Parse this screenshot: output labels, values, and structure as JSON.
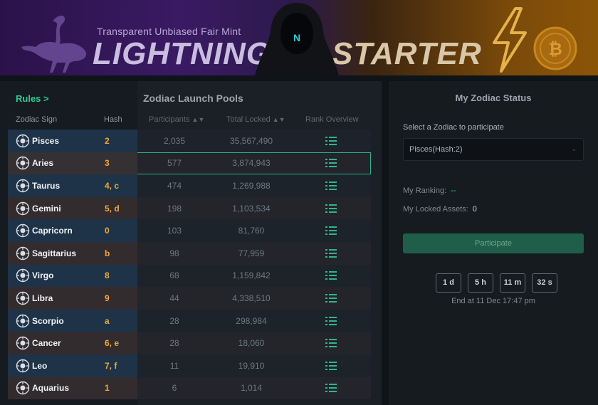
{
  "banner": {
    "tagline": "Transparent Unbiased Fair Mint",
    "title_left": "LIGHTNING",
    "title_right": "STARTER",
    "hood_letter": "N"
  },
  "table": {
    "rules_link": "Rules >",
    "pools_title": "Zodiac Launch Pools",
    "headers": {
      "sign": "Zodiac Sign",
      "hash": "Hash",
      "participants": "Participants",
      "locked": "Total Locked",
      "rank": "Rank Overview"
    },
    "rows": [
      {
        "sign": "Pisces",
        "hash": "2",
        "participants": "2,035",
        "locked": "35,567,490",
        "icon": "pisces-icon"
      },
      {
        "sign": "Aries",
        "hash": "3",
        "participants": "577",
        "locked": "3,874,943",
        "icon": "aries-icon"
      },
      {
        "sign": "Taurus",
        "hash": "4, c",
        "participants": "474",
        "locked": "1,269,988",
        "icon": "taurus-icon"
      },
      {
        "sign": "Gemini",
        "hash": "5, d",
        "participants": "198",
        "locked": "1,103,534",
        "icon": "gemini-icon"
      },
      {
        "sign": "Capricorn",
        "hash": "0",
        "participants": "103",
        "locked": "81,760",
        "icon": "capricorn-icon"
      },
      {
        "sign": "Sagittarius",
        "hash": "b",
        "participants": "98",
        "locked": "77,959",
        "icon": "sagittarius-icon"
      },
      {
        "sign": "Virgo",
        "hash": "8",
        "participants": "68",
        "locked": "1,159,842",
        "icon": "virgo-icon"
      },
      {
        "sign": "Libra",
        "hash": "9",
        "participants": "44",
        "locked": "4,338,510",
        "icon": "libra-icon"
      },
      {
        "sign": "Scorpio",
        "hash": "a",
        "participants": "28",
        "locked": "298,984",
        "icon": "scorpio-icon"
      },
      {
        "sign": "Cancer",
        "hash": "6, e",
        "participants": "28",
        "locked": "18,060",
        "icon": "cancer-icon"
      },
      {
        "sign": "Leo",
        "hash": "7, f",
        "participants": "11",
        "locked": "19,910",
        "icon": "leo-icon"
      },
      {
        "sign": "Aquarius",
        "hash": "1",
        "participants": "6",
        "locked": "1,014",
        "icon": "aquarius-icon"
      }
    ]
  },
  "status": {
    "title": "My Zodiac Status",
    "select_label": "Select a Zodiac to participate",
    "select_value": "Pisces(Hash:2)",
    "ranking_label": "My Ranking:",
    "ranking_value": "--",
    "locked_label": "My Locked Assets:",
    "locked_value": "0",
    "participate_label": "Participate",
    "countdown": {
      "days": "1 d",
      "hours": "5 h",
      "minutes": "11 m",
      "seconds": "32 s"
    },
    "end_at": "End at 11 Dec 17:47 pm"
  },
  "colors": {
    "accent_green": "#2ecc8f",
    "hash_orange": "#f0a73a",
    "participate_bg": "#1f5e48"
  }
}
